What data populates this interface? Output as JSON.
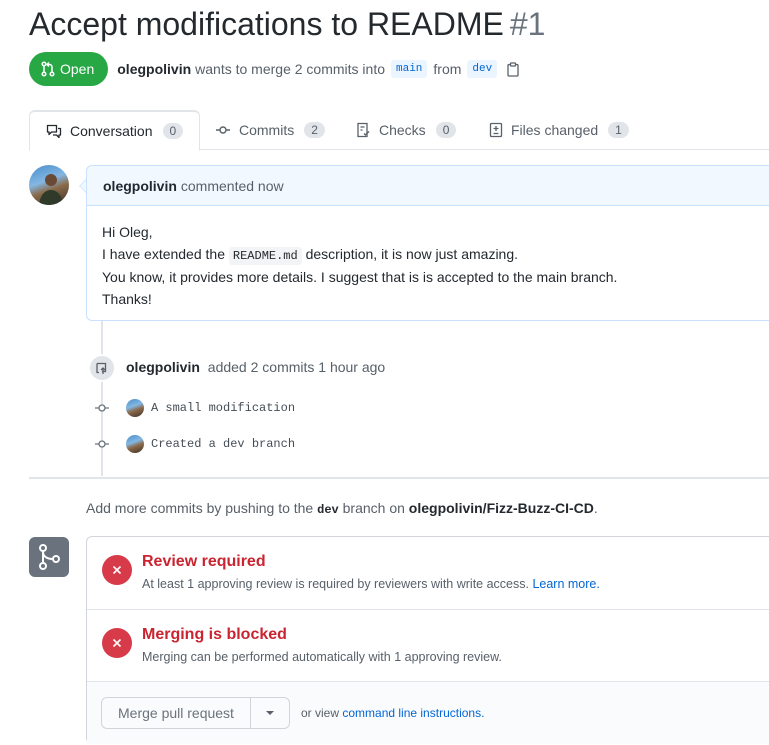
{
  "pr": {
    "title": "Accept modifications to README",
    "number": "#1",
    "state": "Open",
    "author": "olegpolivin",
    "merge_text": "wants to merge 2 commits into",
    "base_branch": "main",
    "from_text": "from",
    "head_branch": "dev"
  },
  "tabs": [
    {
      "label": "Conversation",
      "count": "0",
      "icon": "comment-discussion-icon"
    },
    {
      "label": "Commits",
      "count": "2",
      "icon": "commit-icon"
    },
    {
      "label": "Checks",
      "count": "0",
      "icon": "checklist-icon"
    },
    {
      "label": "Files changed",
      "count": "1",
      "icon": "diff-icon"
    }
  ],
  "comment": {
    "author": "olegpolivin",
    "meta": "commented now",
    "line1": "Hi Oleg,",
    "line2_before": "I have extended the",
    "line2_code": "README.md",
    "line2_after": "description, it is now just amazing.",
    "line3": "You know, it provides more details. I suggest that is is accepted to the main branch.",
    "line4": "Thanks!"
  },
  "event": {
    "author": "olegpolivin",
    "text": "added 2 commits 1 hour ago"
  },
  "commits": [
    {
      "message": "A small modification"
    },
    {
      "message": "Created a dev branch"
    }
  ],
  "push_note": {
    "before": "Add more commits by pushing to the",
    "branch": "dev",
    "middle": "branch on",
    "repo": "olegpolivin/Fizz-Buzz-CI-CD",
    "after": "."
  },
  "checks": [
    {
      "title": "Review required",
      "desc": "At least 1 approving review is required by reviewers with write access.",
      "link": "Learn more."
    },
    {
      "title": "Merging is blocked",
      "desc": "Merging can be performed automatically with 1 approving review.",
      "link": ""
    }
  ],
  "merge": {
    "button": "Merge pull request",
    "or_view": "or view",
    "link": "command line instructions."
  },
  "colors": {
    "open_green": "#28a745",
    "error_red": "#cb2431",
    "link_blue": "#0366d6"
  }
}
